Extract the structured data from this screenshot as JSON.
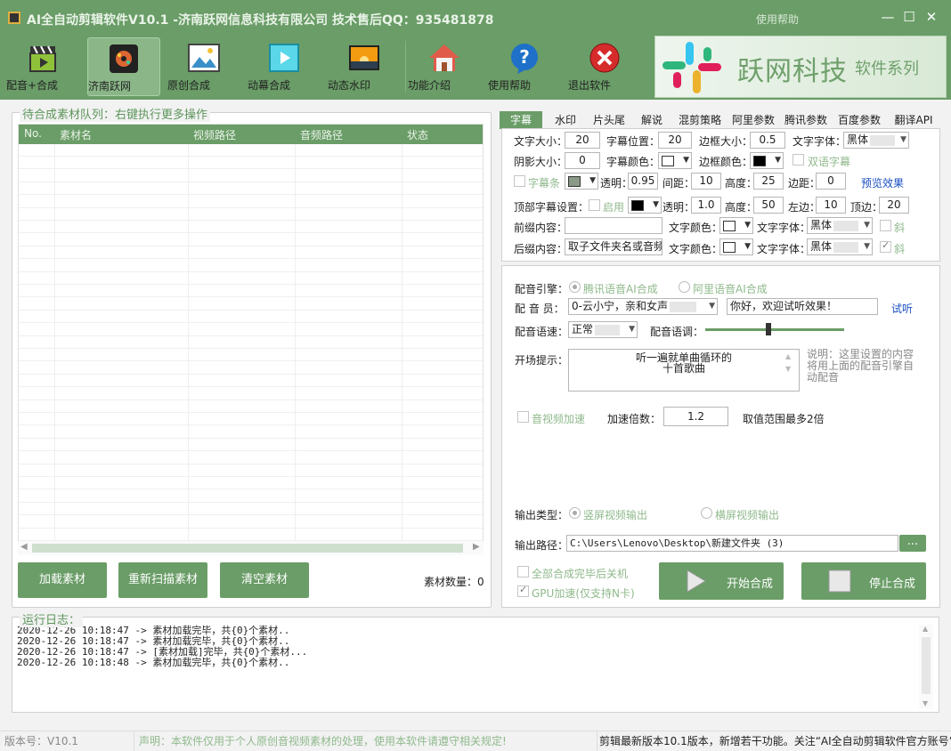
{
  "window": {
    "title": "AI全自动剪辑软件V10.1 -济南跃网信息科技有限公司 技术售后QQ：935481878",
    "help": "使用帮助",
    "minimize": "—",
    "maximize": "☐",
    "close": "✕"
  },
  "toolbar": {
    "items": [
      {
        "label": "配音+合成",
        "icon": "clapperboard-icon"
      },
      {
        "label": "济南跃网",
        "icon": "film-reel-icon"
      },
      {
        "label": "原创合成",
        "icon": "image-icon"
      },
      {
        "label": "动幕合成",
        "icon": "video-play-icon"
      },
      {
        "label": "动态水印",
        "icon": "sunset-photo-icon"
      },
      {
        "label": "功能介绍",
        "icon": "home-icon"
      },
      {
        "label": "使用帮助",
        "icon": "help-icon"
      },
      {
        "label": "退出软件",
        "icon": "exit-icon"
      }
    ],
    "banner_brand": "跃网科技",
    "banner_series": "软件系列"
  },
  "queue": {
    "title": "待合成素材队列：右键执行更多操作",
    "columns": [
      "No.",
      "素材名",
      "视频路径",
      "音频路径",
      "状态"
    ],
    "buttons": {
      "load": "加载素材",
      "rescan": "重新扫描素材",
      "clear": "清空素材"
    },
    "count_label": "素材数量：0"
  },
  "tabs": [
    "字幕",
    "水印",
    "片头尾",
    "解说",
    "混剪策略",
    "阿里参数",
    "腾讯参数",
    "百度参数",
    "翻译API"
  ],
  "subtitle": {
    "font_size_label": "文字大小：",
    "font_size": "20",
    "position_label": "字幕位置：",
    "position": "20",
    "border_label": "边框大小：",
    "border": "0.5",
    "font_label": "文字字体：",
    "font": "黑体",
    "shadow_label": "阴影大小：",
    "shadow": "0",
    "color_label": "字幕颜色：",
    "border_color_label": "边框颜色：",
    "bilingual_label": "双语字幕",
    "bar_label": "字幕条",
    "alpha_label": "透明：",
    "alpha": "0.95",
    "spacing_label": "间距：",
    "spacing": "10",
    "height_label": "高度：",
    "height": "25",
    "margin_label": "边距：",
    "margin": "0",
    "preview_label": "预览效果",
    "top_label": "顶部字幕设置：",
    "enable_label": "启用",
    "top_alpha_label": "透明：",
    "top_alpha": "1.0",
    "top_height_label": "高度：",
    "top_height": "50",
    "left_label": "左边：",
    "left": "10",
    "top_edge_label": "顶边：",
    "top_edge": "20",
    "prefix_label": "前缀内容：",
    "prefix": "",
    "prefix_color_label": "文字颜色：",
    "prefix_font_label": "文字字体：",
    "prefix_font": "黑体",
    "italic_label": "斜",
    "suffix_label": "后缀内容：",
    "suffix": "取子文件夹名或音频",
    "suffix_color_label": "文字颜色：",
    "suffix_font_label": "文字字体：",
    "suffix_font": "黑体",
    "suffix_italic_label": "斜"
  },
  "voice": {
    "engine_label": "配音引擎：",
    "engine_tencent": "腾讯语音AI合成",
    "engine_ali": "阿里语音AI合成",
    "speaker_label": "配 音 员：",
    "speaker": "0-云小宁，亲和女声",
    "sample_text": "你好，欢迎试听效果！",
    "try_label": "试听",
    "speed_label": "配音语速：",
    "speed": "正常",
    "tone_label": "配音语调：",
    "tone_level": 0.45,
    "intro_label": "开场提示：",
    "intro_text": "听一遍就单曲循环的\n十首歌曲",
    "note": "说明：这里设置的内容将用上面的配音引擎自动配音",
    "accel_label": "音视频加速",
    "accel_ratio_label": "加速倍数：",
    "accel_ratio": "1.2",
    "accel_range": "取值范围最多2倍",
    "output_type_label": "输出类型：",
    "output_vertical": "竖屏视频输出",
    "output_horizontal": "横屏视频输出",
    "output_path_label": "输出路径：",
    "output_path": "C:\\Users\\Lenovo\\Desktop\\新建文件夹 (3)",
    "browse": "...",
    "shutdown_label": "全部合成完毕后关机",
    "gpu_label": "GPU加速(仅支持N卡)",
    "start_label": "开始合成",
    "stop_label": "停止合成"
  },
  "log": {
    "title": "运行日志：",
    "lines": [
      "2020-12-26 10:18:47 -> 素材加载完毕，共{0}个素材..",
      "2020-12-26 10:18:47 -> 素材加载完毕，共{0}个素材..",
      "2020-12-26 10:18:47 -> [素材加载]完毕，共{0}个素材...",
      "2020-12-26 10:18:48 -> 素材加载完毕，共{0}个素材.."
    ]
  },
  "status": {
    "version": "版本号：V10.1",
    "disclaimer": "声明：本软件仅用于个人原创音视频素材的处理，使用本软件请遵守相关规定!",
    "news": "剪辑最新版本10.1版本，新增若干功能。关注“AI全自动剪辑软件官方账号”"
  },
  "colors": {
    "accent": "#6a9d67",
    "accent_light": "#8bb788",
    "text_dim": "#8fb98c",
    "link": "#1a4fc4"
  }
}
